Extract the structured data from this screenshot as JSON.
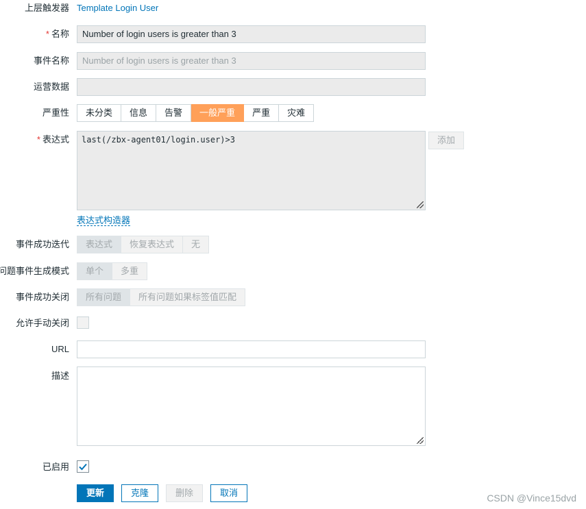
{
  "form": {
    "parent_trigger": {
      "label": "上层触发器",
      "value": "Template Login User"
    },
    "name": {
      "required": "*",
      "label": "名称",
      "value": "Number of login users is greater than 3"
    },
    "event_name": {
      "label": "事件名称",
      "placeholder": "Number of login users is greater than 3"
    },
    "operational_data": {
      "label": "运营数据",
      "value": ""
    },
    "severity": {
      "label": "严重性",
      "options": [
        "未分类",
        "信息",
        "告警",
        "一般严重",
        "严重",
        "灾难"
      ],
      "selected": "一般严重"
    },
    "expression": {
      "required": "*",
      "label": "表达式",
      "value": "last(/zbx-agent01/login.user)>3",
      "add_button": "添加",
      "constructor_link": "表达式构造器"
    },
    "ok_event_generation": {
      "label": "事件成功迭代",
      "options": [
        "表达式",
        "恢复表达式",
        "无"
      ],
      "selected": "表达式"
    },
    "problem_event_mode": {
      "label": "问题事件生成模式",
      "options": [
        "单个",
        "多重"
      ],
      "selected": "单个"
    },
    "ok_event_closes": {
      "label": "事件成功关闭",
      "options": [
        "所有问题",
        "所有问题如果标签值匹配"
      ],
      "selected": "所有问题"
    },
    "allow_manual_close": {
      "label": "允许手动关闭",
      "checked": false
    },
    "url": {
      "label": "URL",
      "value": ""
    },
    "description": {
      "label": "描述",
      "value": ""
    },
    "enabled": {
      "label": "已启用",
      "checked": true
    }
  },
  "actions": {
    "update": "更新",
    "clone": "克隆",
    "delete": "删除",
    "cancel": "取消"
  },
  "watermark": "CSDN @Vince15dvd",
  "colors": {
    "accent": "#0275b8",
    "severity_active": "#ffa059",
    "required": "#e33734"
  }
}
